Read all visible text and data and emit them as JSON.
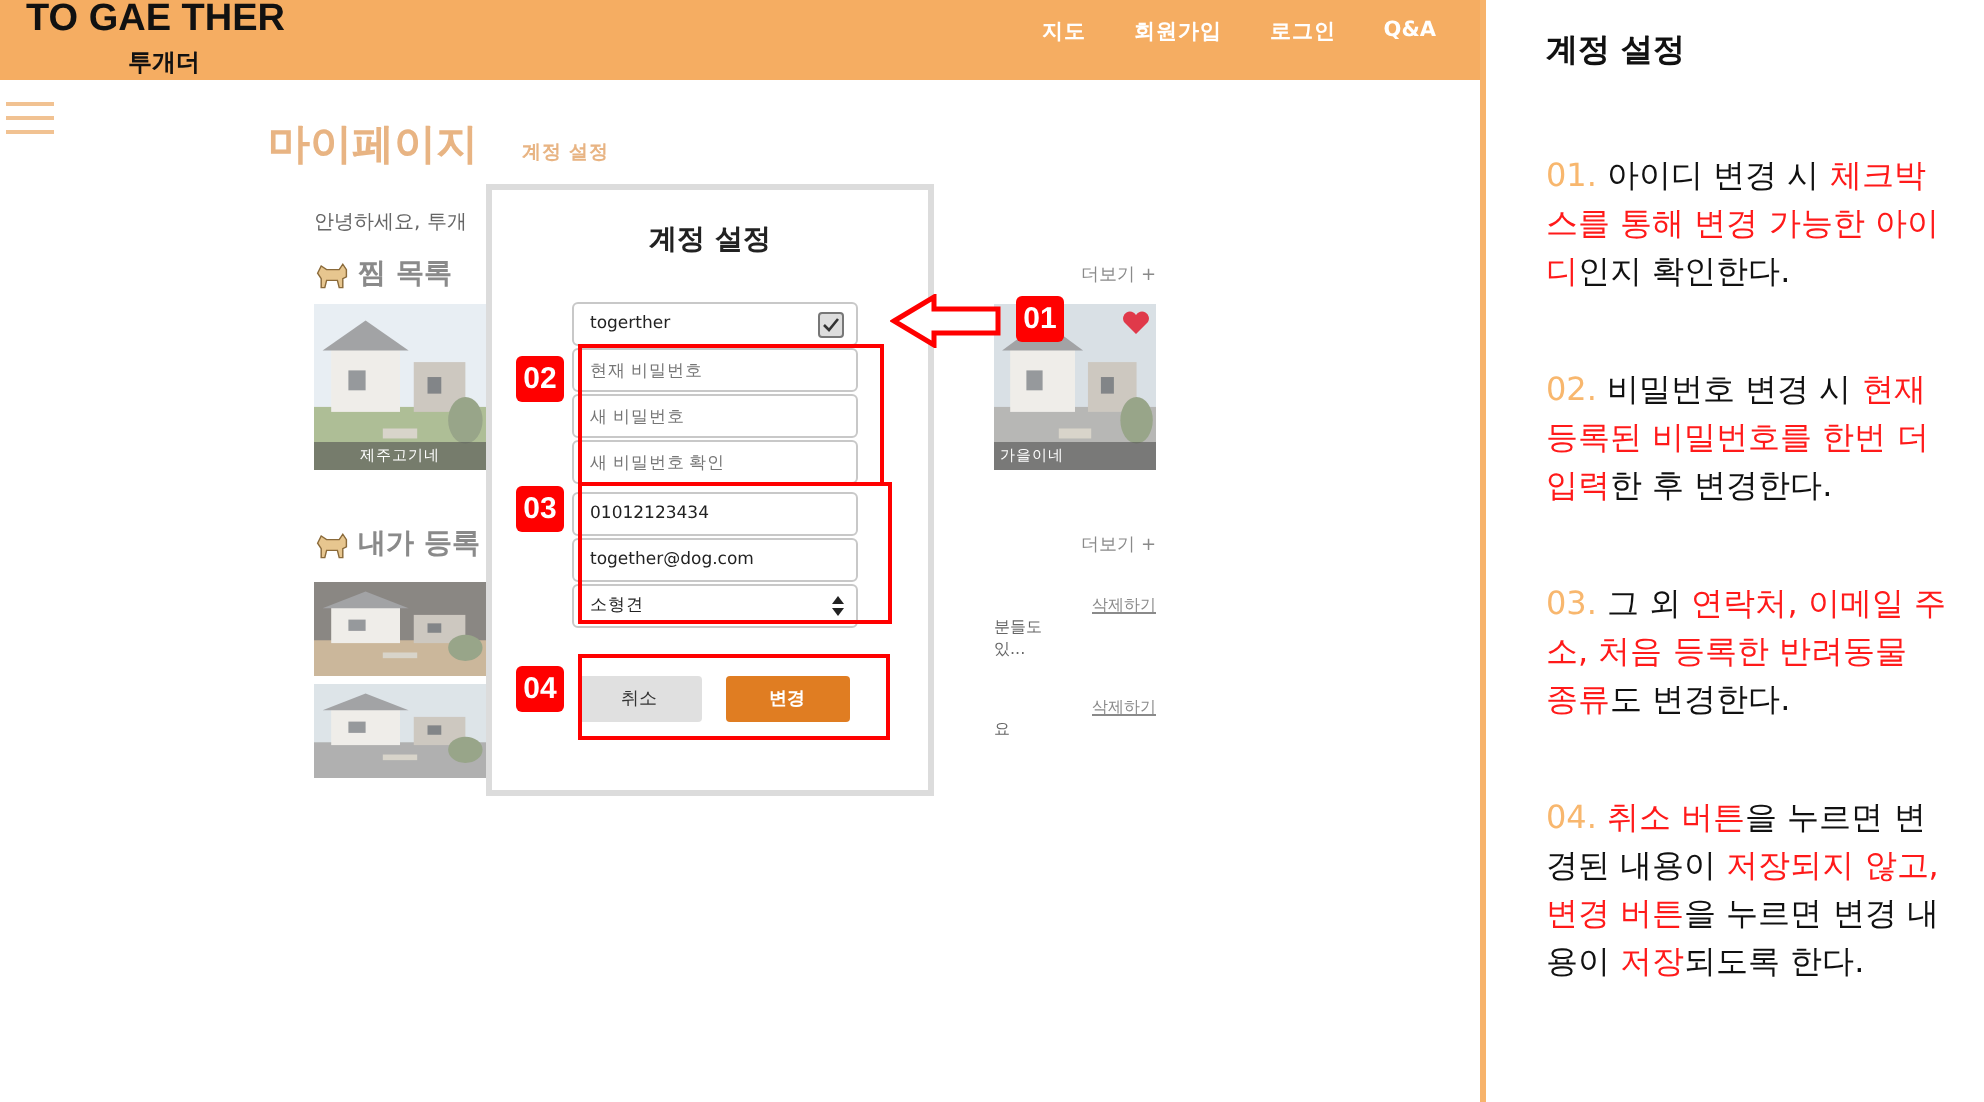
{
  "header": {
    "logo": "TO GAE THER",
    "logo_sub": "투개더",
    "nav": [
      {
        "label": "지도"
      },
      {
        "label": "회원가입"
      },
      {
        "label": "로그인"
      },
      {
        "label": "Q&A"
      }
    ]
  },
  "page": {
    "title": "마이페이지",
    "subtitle": "계정 설정",
    "greeting": "안녕하세요, 투개",
    "favorites": {
      "title": "찜 목록",
      "more": "더보기 +",
      "captions": [
        "제주고기네",
        "가을이네"
      ]
    },
    "registered": {
      "title": "내가 등록",
      "more": "더보기 +",
      "rows": [
        {
          "snippet": [
            "분들도",
            "있..."
          ],
          "delete": "삭제하기"
        },
        {
          "snippet": [
            "요"
          ],
          "delete": "삭제하기"
        }
      ]
    }
  },
  "modal": {
    "title": "계정 설정",
    "id_field": {
      "value": "togerther",
      "checked": true
    },
    "password_fields": [
      {
        "placeholder": "현재 비밀번호"
      },
      {
        "placeholder": "새 비밀번호"
      },
      {
        "placeholder": "새 비밀번호 확인"
      }
    ],
    "phone": {
      "value": "01012123434"
    },
    "email": {
      "value": "together@dog.com"
    },
    "breed": {
      "value": "소형견"
    },
    "buttons": [
      {
        "label": "취소",
        "kind": "cancel"
      },
      {
        "label": "변경",
        "kind": "primary"
      }
    ]
  },
  "badges": [
    "01",
    "02",
    "03",
    "04"
  ],
  "description": {
    "title": "계정 설정",
    "items": [
      {
        "number": "01.",
        "segments": [
          {
            "text": "아이디 변경 시 ",
            "highlight": false
          },
          {
            "text": "체크박스를 통해 변경 가능한 아이디",
            "highlight": true
          },
          {
            "text": "인지 확인한다.",
            "highlight": false
          }
        ]
      },
      {
        "number": "02.",
        "segments": [
          {
            "text": "비밀번호 변경 시 ",
            "highlight": false
          },
          {
            "text": "현재 등록된 비밀번호를 한번 더 입력",
            "highlight": true
          },
          {
            "text": "한 후 변경한다.",
            "highlight": false
          }
        ]
      },
      {
        "number": "03.",
        "segments": [
          {
            "text": "그 외 ",
            "highlight": false
          },
          {
            "text": "연락처, 이메일 주소, 처음 등록한 반려동물 종류",
            "highlight": true
          },
          {
            "text": "도 변경한다.",
            "highlight": false
          }
        ]
      },
      {
        "number": "04.",
        "segments": [
          {
            "text": "취소 버튼",
            "highlight": true
          },
          {
            "text": "을 누르면 변경된 내용이 ",
            "highlight": false
          },
          {
            "text": "저장되지 않고, 변경 버튼",
            "highlight": true
          },
          {
            "text": "을 누르면 변경 내용이 ",
            "highlight": false
          },
          {
            "text": "저장",
            "highlight": true
          },
          {
            "text": "되도록 한다.",
            "highlight": false
          }
        ]
      }
    ]
  }
}
